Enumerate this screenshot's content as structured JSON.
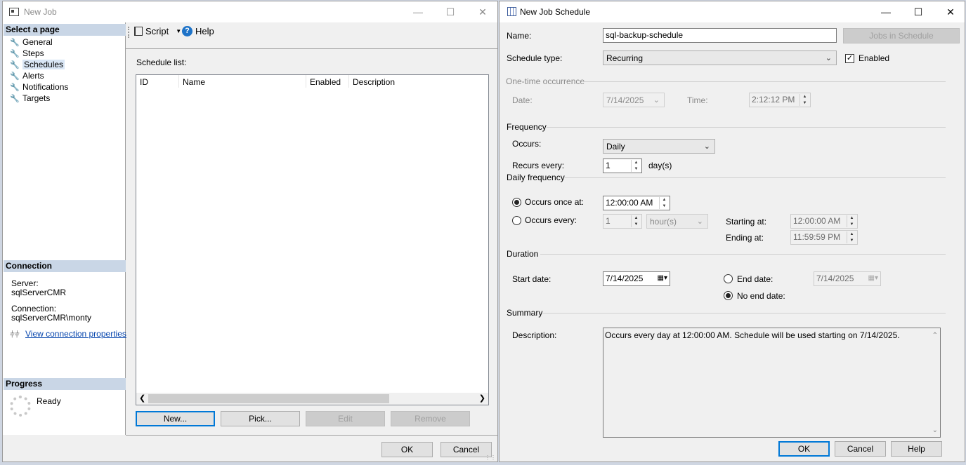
{
  "left_window": {
    "title": "New Job",
    "select_page_header": "Select a page",
    "nav_items": [
      "General",
      "Steps",
      "Schedules",
      "Alerts",
      "Notifications",
      "Targets"
    ],
    "toolbar": {
      "script_label": "Script",
      "help_label": "Help"
    },
    "schedule_list_label": "Schedule list:",
    "columns": [
      "ID",
      "Name",
      "Enabled",
      "Description"
    ],
    "connection_header": "Connection",
    "server_label": "Server:",
    "server_value": "sqlServerCMR",
    "connection_label": "Connection:",
    "connection_value": "sqlServerCMR\\monty",
    "view_connection_link": "View connection properties",
    "progress_header": "Progress",
    "progress_status": "Ready",
    "buttons": {
      "new": "New...",
      "pick": "Pick...",
      "edit": "Edit",
      "remove": "Remove",
      "ok": "OK",
      "cancel": "Cancel"
    }
  },
  "right_window": {
    "title": "New Job Schedule",
    "name_label": "Name:",
    "name_value": "sql-backup-schedule",
    "jobs_in_schedule_button": "Jobs in Schedule",
    "schedule_type_label": "Schedule type:",
    "schedule_type_value": "Recurring",
    "enabled_label": "Enabled",
    "enabled_checked": true,
    "one_time": {
      "header": "One-time occurrence",
      "date_label": "Date:",
      "date_value": "7/14/2025",
      "time_label": "Time:",
      "time_value": "2:12:12 PM"
    },
    "frequency": {
      "header": "Frequency",
      "occurs_label": "Occurs:",
      "occurs_value": "Daily",
      "recurs_label": "Recurs every:",
      "recurs_value": "1",
      "recurs_unit": "day(s)"
    },
    "daily_frequency": {
      "header": "Daily frequency",
      "once_label": "Occurs once at:",
      "once_value": "12:00:00 AM",
      "every_label": "Occurs every:",
      "every_value": "1",
      "every_unit": "hour(s)",
      "starting_label": "Starting at:",
      "starting_value": "12:00:00 AM",
      "ending_label": "Ending at:",
      "ending_value": "11:59:59 PM",
      "selected": "once"
    },
    "duration": {
      "header": "Duration",
      "start_label": "Start date:",
      "start_value": "7/14/2025",
      "end_label": "End date:",
      "end_value": "7/14/2025",
      "no_end_label": "No end date:",
      "selected": "no_end"
    },
    "summary": {
      "header": "Summary",
      "description_label": "Description:",
      "description_value": "Occurs every day at 12:00:00 AM. Schedule will be used starting on 7/14/2025."
    },
    "buttons": {
      "ok": "OK",
      "cancel": "Cancel",
      "help": "Help"
    }
  },
  "colors": {
    "accent": "#0078d7",
    "section_header": "#c9d6e6",
    "link": "#0645ad",
    "help_icon": "#1e73c8"
  }
}
